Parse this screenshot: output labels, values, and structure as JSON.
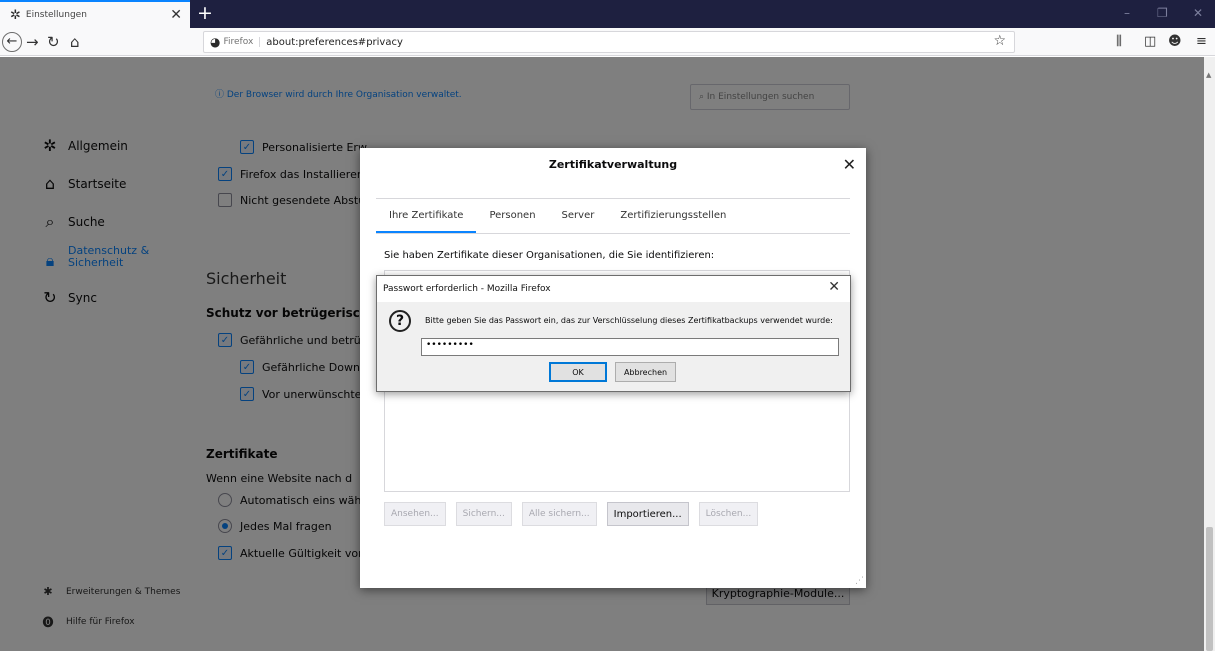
{
  "tab": {
    "title": "Einstellungen",
    "icon": "gear-icon"
  },
  "window_controls": {
    "minimize": "–",
    "restore": "❐",
    "close": "✕"
  },
  "navbar": {
    "identity": "Firefox",
    "url": "about:preferences#privacy"
  },
  "page": {
    "notice": "Der Browser wird durch Ihre Organisation verwaltet.",
    "search_placeholder": "In Einstellungen suchen",
    "sidebar": {
      "items": [
        {
          "label": "Allgemein",
          "icon": "gear-icon"
        },
        {
          "label": "Startseite",
          "icon": "home-icon"
        },
        {
          "label": "Suche",
          "icon": "search-icon"
        },
        {
          "label": "Datenschutz & Sicherheit",
          "icon": "lock-icon",
          "active": true
        },
        {
          "label": "Sync",
          "icon": "sync-icon"
        }
      ],
      "footer": [
        {
          "label": "Erweiterungen & Themes",
          "icon": "puzzle-icon"
        },
        {
          "label": "Hilfe für Firefox",
          "icon": "help-icon"
        }
      ]
    },
    "options": {
      "personalized": "Personalisierte Erw",
      "install": "Firefox das Installieren",
      "unsent": "Nicht gesendete Abstu"
    },
    "security": {
      "heading": "Sicherheit",
      "subheading": "Schutz vor betrügerisch",
      "dangerous": "Gefährliche und betrüg",
      "downloads": "Gefährliche Downl",
      "unwanted": "Vor unerwünschter"
    },
    "certificates": {
      "heading": "Zertifikate",
      "desc": "Wenn eine Website nach d",
      "auto": "Automatisch eins wähl",
      "ask": "Jedes Mal fragen",
      "validity": "Aktuelle Gültigkeit von",
      "crypto_button": "Kryptographie-Module..."
    }
  },
  "cert_dialog": {
    "title": "Zertifikatverwaltung",
    "tabs": [
      "Ihre Zertifikate",
      "Personen",
      "Server",
      "Zertifizierungsstellen"
    ],
    "active_tab": 0,
    "description": "Sie haben Zertifikate dieser Organisationen, die Sie identifizieren:",
    "buttons": [
      {
        "label": "Ansehen...",
        "enabled": false
      },
      {
        "label": "Sichern...",
        "enabled": false
      },
      {
        "label": "Alle sichern...",
        "enabled": false
      },
      {
        "label": "Importieren...",
        "enabled": true
      },
      {
        "label": "Löschen...",
        "enabled": false
      }
    ]
  },
  "password_dialog": {
    "title": "Passwort erforderlich - Mozilla Firefox",
    "message": "Bitte geben Sie das Passwort ein, das zur Verschlüsselung dieses Zertifikatbackups verwendet wurde:",
    "password_value": "•••••••••",
    "ok_label": "OK",
    "cancel_label": "Abbrechen"
  },
  "colors": {
    "accent": "#0a84ff",
    "tabbar": "#1e2040"
  }
}
